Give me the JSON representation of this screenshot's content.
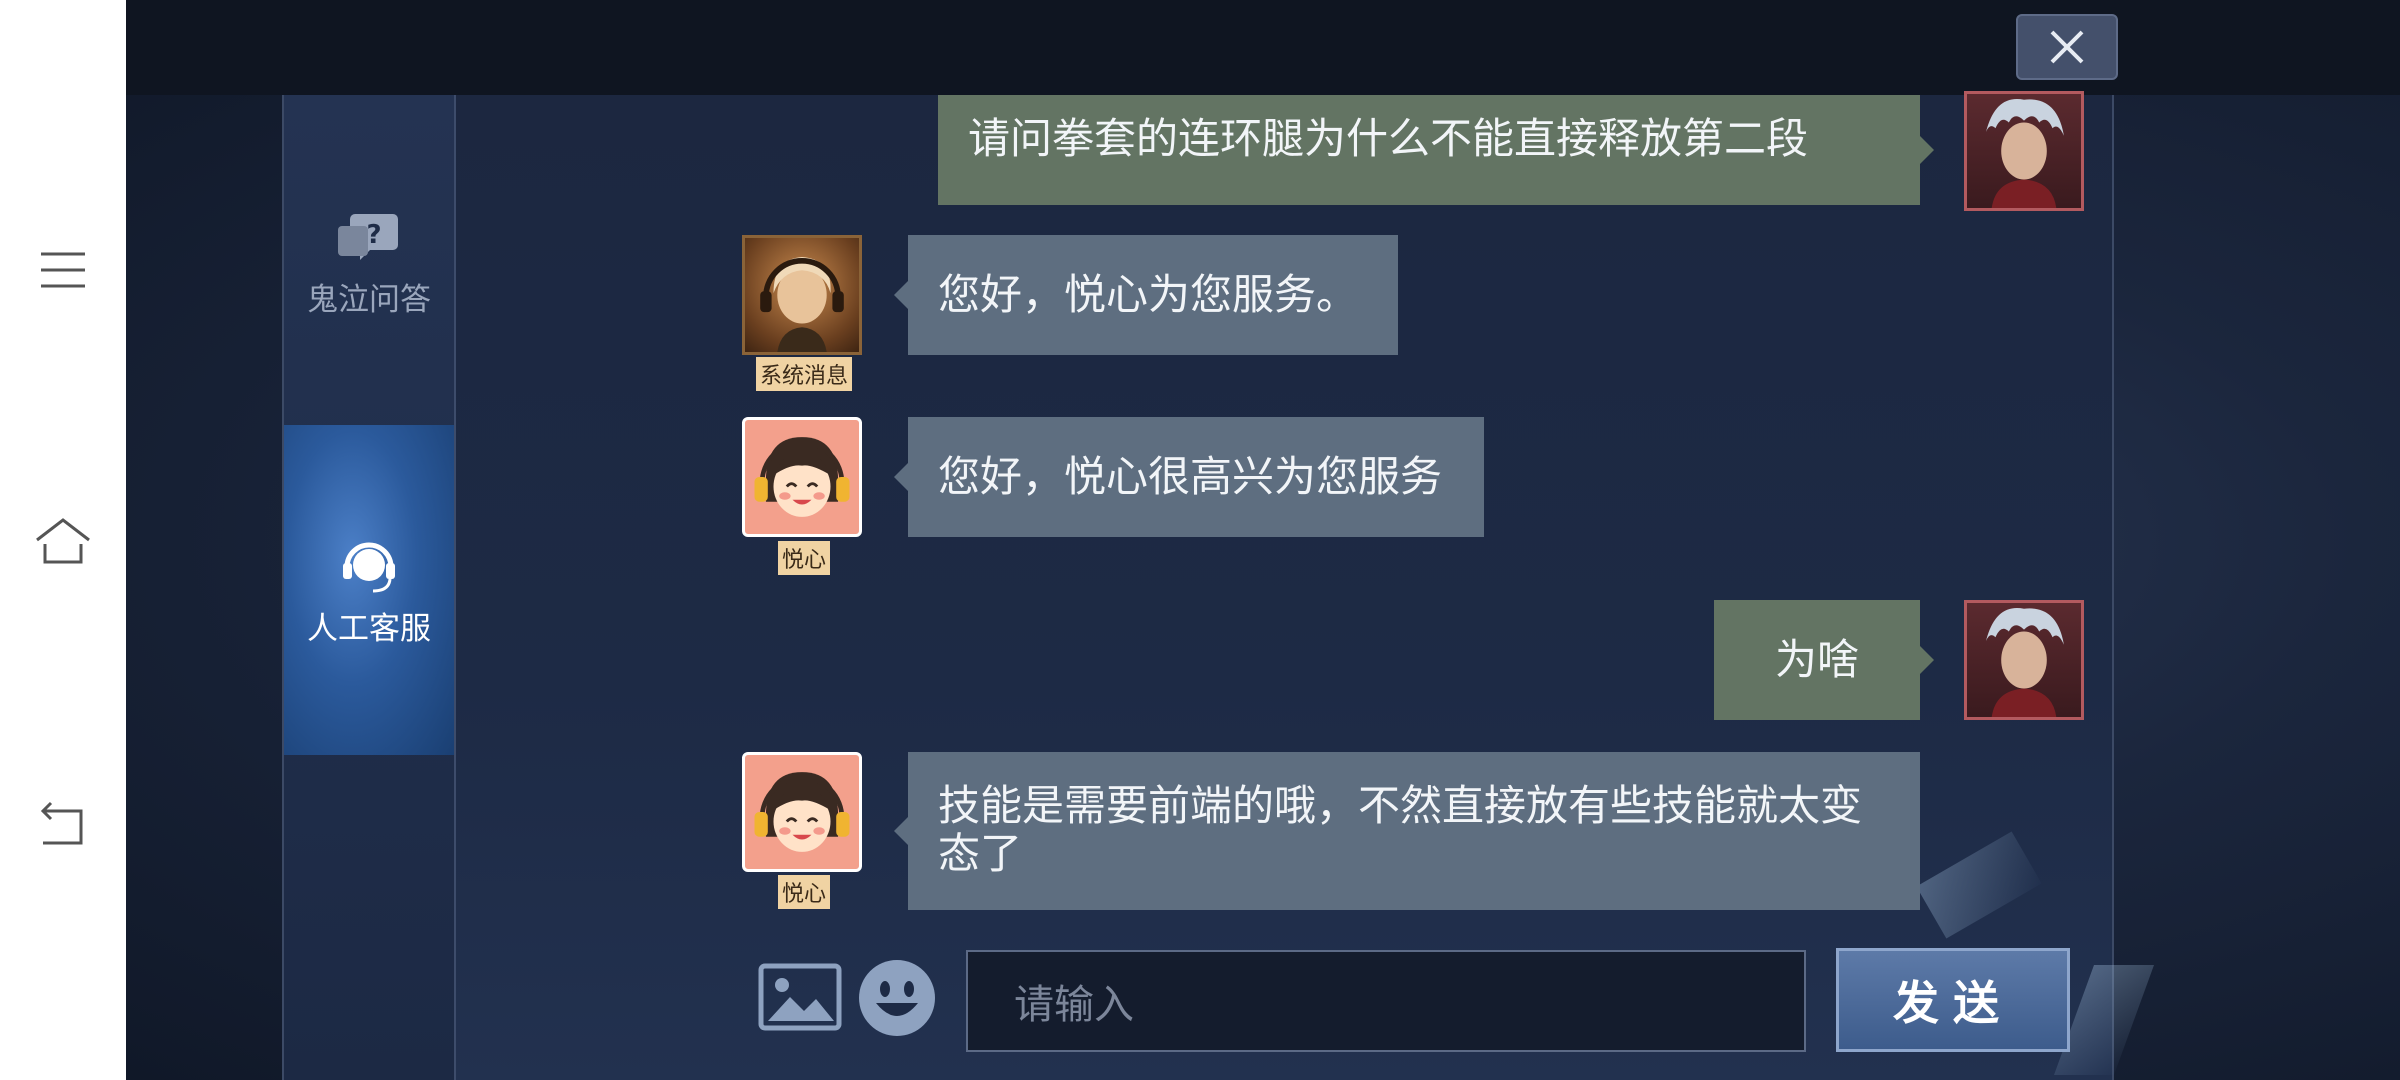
{
  "window": {
    "close_label": "×"
  },
  "tabs": [
    {
      "label": "鬼泣问答",
      "icon": "question-chat-icon",
      "active": false
    },
    {
      "label": "人工客服",
      "icon": "headset-icon",
      "active": true
    }
  ],
  "messages": [
    {
      "side": "right",
      "text": "请问拳套的连环腿为什么不能直接释放第二段",
      "avatar": "player-avatar"
    },
    {
      "side": "left",
      "text": "您好，悦心为您服务。",
      "avatar": "system-avatar",
      "sender": "系统消息"
    },
    {
      "side": "left",
      "text": "您好，悦心很高兴为您服务",
      "avatar": "agent-avatar",
      "sender": "悦心"
    },
    {
      "side": "right",
      "text": "为啥",
      "avatar": "player-avatar"
    },
    {
      "side": "left",
      "text": "技能是需要前端的哦，不然直接放有些技能就太变态了",
      "avatar": "agent-avatar",
      "sender": "悦心"
    }
  ],
  "composer": {
    "placeholder": "请输入",
    "send_label": "发送"
  },
  "colors": {
    "bubble_left": "#5e6e80",
    "bubble_right": "#637463",
    "active_tab": "#2b5a9c"
  }
}
